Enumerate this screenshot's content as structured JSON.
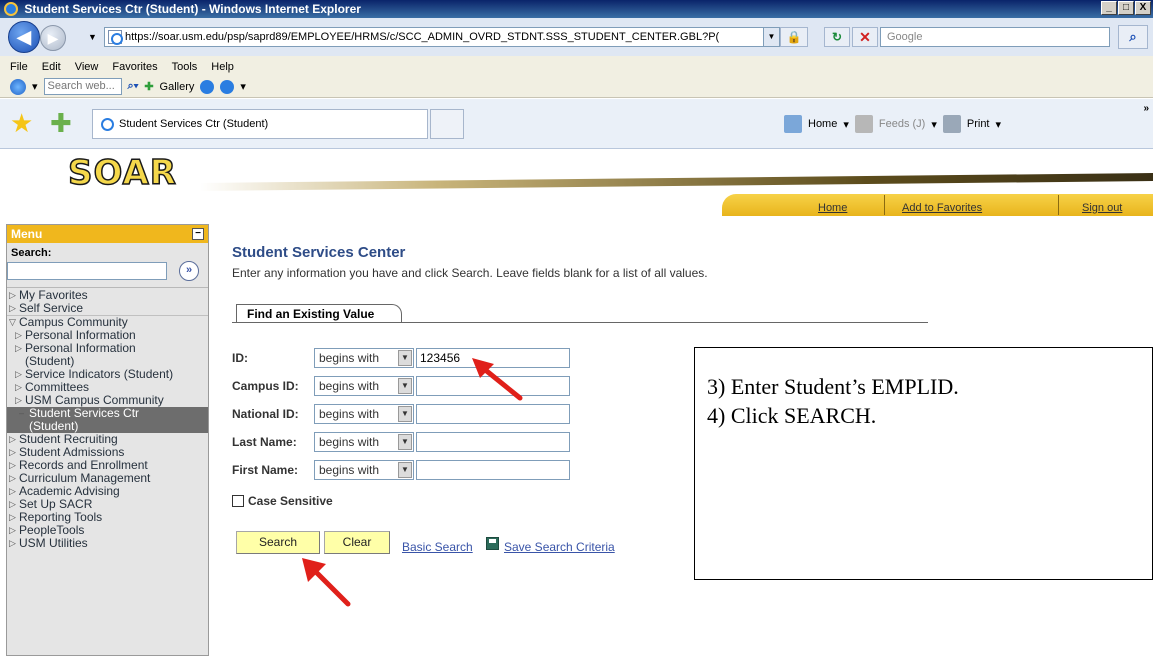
{
  "window": {
    "title": "Student Services Ctr (Student) - Windows Internet Explorer",
    "controls": [
      "_",
      "□",
      "X"
    ]
  },
  "address_bar": {
    "url": "https://soar.usm.edu/psp/saprd89/EMPLOYEE/HRMS/c/SCC_ADMIN_OVRD_STDNT.SSS_STUDENT_CENTER.GBL?P(",
    "search_placeholder": "Google"
  },
  "menu_bar": [
    "File",
    "Edit",
    "View",
    "Favorites",
    "Tools",
    "Help"
  ],
  "toolbar": {
    "search_web_placeholder": "Search web...",
    "gallery_label": "Gallery"
  },
  "tab_bar": {
    "active_tab": "Student Services Ctr (Student)",
    "home_label": "Home",
    "feeds_label": "Feeds (J)",
    "print_label": "Print"
  },
  "header": {
    "logo_text": "SOAR",
    "links": {
      "home": "Home",
      "add_to_favorites": "Add to Favorites",
      "sign_out": "Sign out"
    }
  },
  "sidebar": {
    "title": "Menu",
    "search_label": "Search:",
    "items": [
      {
        "label": "My Favorites",
        "level": 0,
        "state": "closed"
      },
      {
        "label": "Self Service",
        "level": 0,
        "state": "closed"
      },
      {
        "label": "Campus Community",
        "level": 0,
        "state": "open"
      },
      {
        "label": "Personal Information",
        "level": 1,
        "state": "closed"
      },
      {
        "label": "Personal Information (Student)",
        "level": 1,
        "state": "closed"
      },
      {
        "label": "Service Indicators (Student)",
        "level": 1,
        "state": "closed"
      },
      {
        "label": "Committees",
        "level": 1,
        "state": "closed"
      },
      {
        "label": "USM Campus Community",
        "level": 1,
        "state": "closed"
      },
      {
        "label": "Student Services Ctr (Student)",
        "level": 1,
        "state": "selected"
      },
      {
        "label": "Student Recruiting",
        "level": 0,
        "state": "closed"
      },
      {
        "label": "Student Admissions",
        "level": 0,
        "state": "closed"
      },
      {
        "label": "Records and Enrollment",
        "level": 0,
        "state": "closed"
      },
      {
        "label": "Curriculum Management",
        "level": 0,
        "state": "closed"
      },
      {
        "label": "Academic Advising",
        "level": 0,
        "state": "closed"
      },
      {
        "label": "Set Up SACR",
        "level": 0,
        "state": "closed"
      },
      {
        "label": "Reporting Tools",
        "level": 0,
        "state": "closed"
      },
      {
        "label": "PeopleTools",
        "level": 0,
        "state": "closed"
      },
      {
        "label": "USM Utilities",
        "level": 0,
        "state": "closed"
      }
    ]
  },
  "main": {
    "title": "Student Services Center",
    "instruction": "Enter any information you have and click Search. Leave fields blank for a list of all values.",
    "tab_label": "Find an Existing Value",
    "fields": [
      {
        "label": "ID:",
        "operator": "begins with",
        "value": "123456"
      },
      {
        "label": "Campus ID:",
        "operator": "begins with",
        "value": ""
      },
      {
        "label": "National ID:",
        "operator": "begins with",
        "value": ""
      },
      {
        "label": "Last Name:",
        "operator": "begins with",
        "value": ""
      },
      {
        "label": "First Name:",
        "operator": "begins with",
        "value": ""
      }
    ],
    "case_sensitive_label": "Case Sensitive",
    "search_button": "Search",
    "clear_button": "Clear",
    "basic_search_link": "Basic Search",
    "save_criteria_link": "Save Search Criteria"
  },
  "annotation": {
    "line1": "3) Enter Student’s EMPLID.",
    "line2": "4) Click SEARCH.",
    "arrow_color": "#e0201a"
  }
}
